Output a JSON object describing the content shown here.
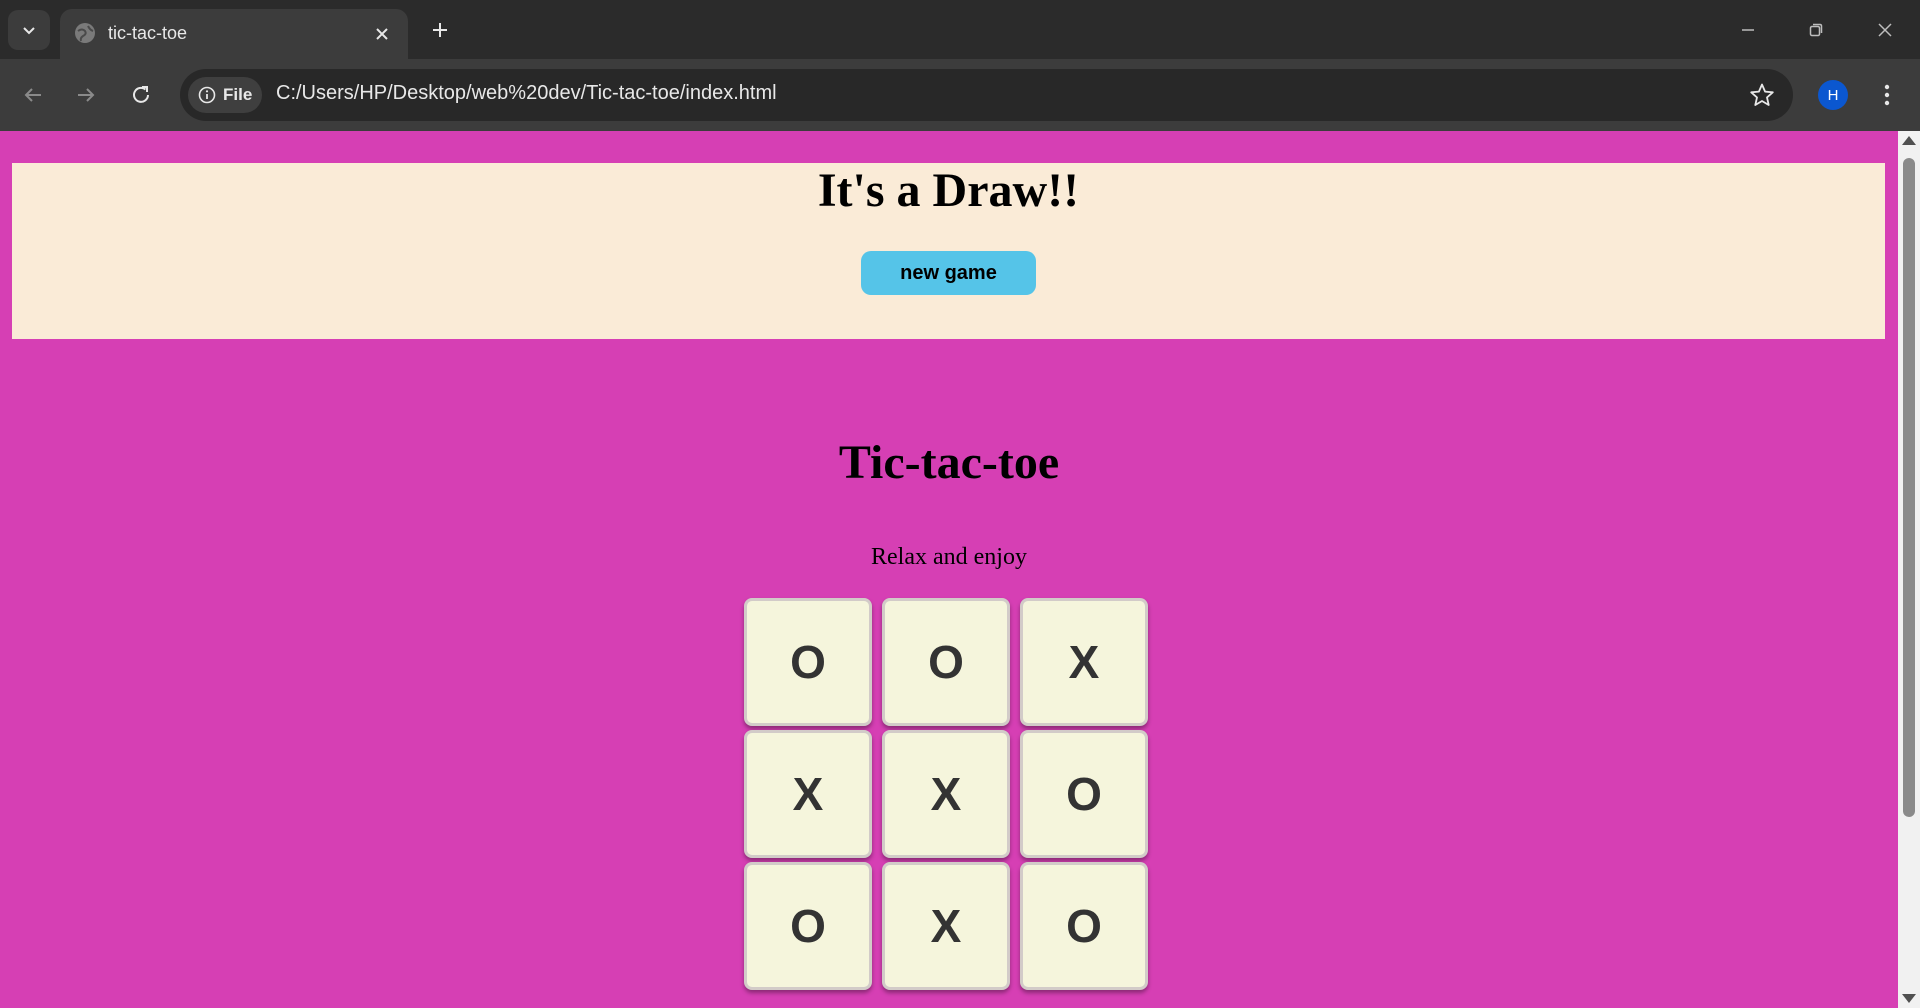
{
  "browser": {
    "tab": {
      "title": "tic-tac-toe"
    },
    "address": {
      "chip_label": "File",
      "url": "C:/Users/HP/Desktop/web%20dev/Tic-tac-toe/index.html"
    },
    "profile_initial": "H",
    "icons": [
      "tab-list-chevron-icon",
      "globe-icon",
      "close-icon",
      "plus-icon",
      "minimize-icon",
      "restore-icon",
      "window-close-icon",
      "back-arrow-icon",
      "forward-arrow-icon",
      "reload-icon",
      "info-icon",
      "star-icon",
      "kebab-menu-icon"
    ]
  },
  "page": {
    "result_message": "It's a Draw!!",
    "new_game_label": "new game",
    "title": "Tic-tac-toe",
    "subtitle": "Relax and enjoy",
    "board": [
      [
        "O",
        "O",
        "X"
      ],
      [
        "X",
        "X",
        "O"
      ],
      [
        "O",
        "X",
        "O"
      ]
    ],
    "colors": {
      "page_background": "#d63fb4",
      "banner_background": "#faebd7",
      "button_background": "#55c4e8",
      "cell_background": "#f5f5dc",
      "mark_color": "#333333"
    }
  }
}
